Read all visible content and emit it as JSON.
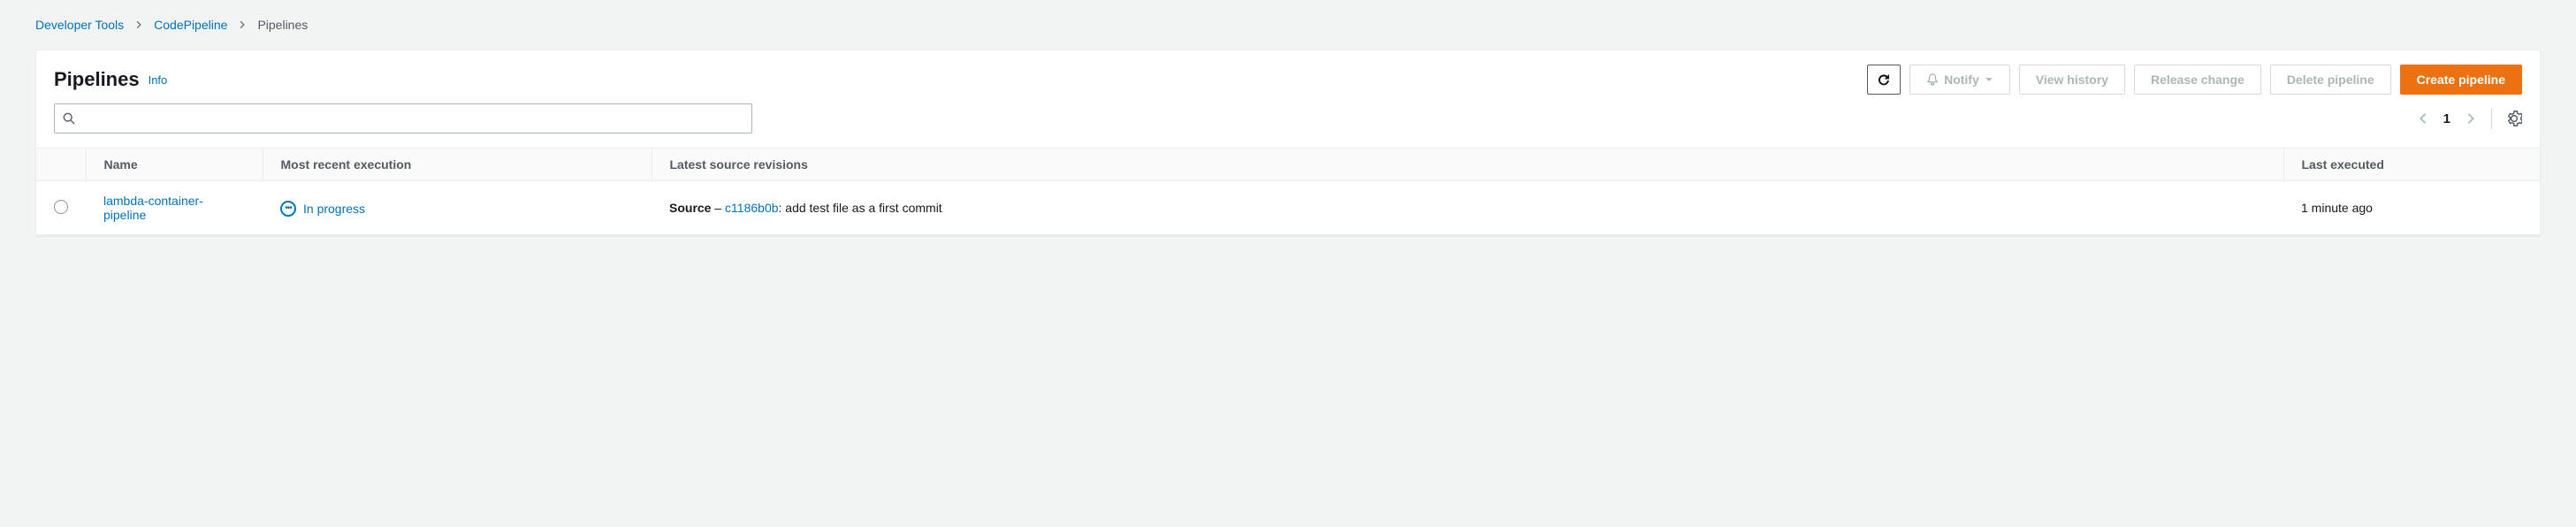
{
  "breadcrumb": {
    "item1": "Developer Tools",
    "item2": "CodePipeline",
    "current": "Pipelines"
  },
  "header": {
    "title": "Pipelines",
    "info": "Info"
  },
  "actions": {
    "notify": "Notify",
    "view_history": "View history",
    "release_change": "Release change",
    "delete_pipeline": "Delete pipeline",
    "create_pipeline": "Create pipeline"
  },
  "search": {
    "placeholder": ""
  },
  "pagination": {
    "page": "1"
  },
  "table": {
    "headers": {
      "name": "Name",
      "execution": "Most recent execution",
      "revisions": "Latest source revisions",
      "last_executed": "Last executed"
    },
    "row": {
      "name": "lambda-container-pipeline",
      "status": "In progress",
      "rev_label": "Source",
      "rev_sep": " – ",
      "rev_commit": "c1186b0b",
      "rev_msg": ": add test file as a first commit",
      "last_executed": "1 minute ago"
    }
  }
}
